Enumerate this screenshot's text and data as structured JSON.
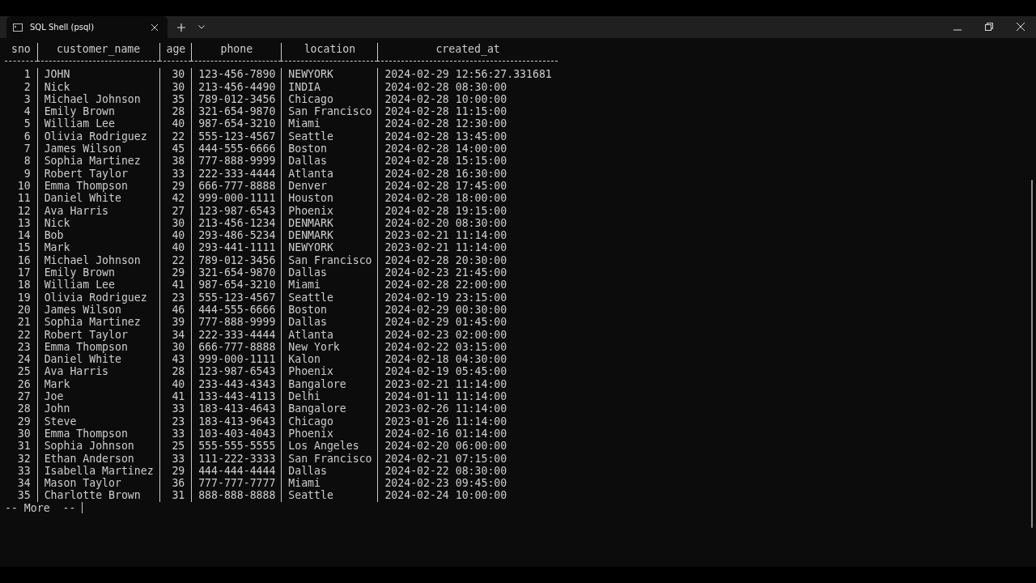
{
  "window": {
    "title": "SQL Shell (psql)"
  },
  "table": {
    "columns": [
      "sno",
      "customer_name",
      "age",
      "phone",
      "location",
      "created_at"
    ],
    "rows": [
      [
        "1",
        "JOHN",
        "30",
        "123-456-7890",
        "NEWYORK",
        "2024-02-29 12:56:27.331681"
      ],
      [
        "2",
        "Nick",
        "30",
        "213-456-4490",
        "INDIA",
        "2024-02-28 08:30:00"
      ],
      [
        "3",
        "Michael Johnson",
        "35",
        "789-012-3456",
        "Chicago",
        "2024-02-28 10:00:00"
      ],
      [
        "4",
        "Emily Brown",
        "28",
        "321-654-9870",
        "San Francisco",
        "2024-02-28 11:15:00"
      ],
      [
        "5",
        "William Lee",
        "40",
        "987-654-3210",
        "Miami",
        "2024-02-28 12:30:00"
      ],
      [
        "6",
        "Olivia Rodriguez",
        "22",
        "555-123-4567",
        "Seattle",
        "2024-02-28 13:45:00"
      ],
      [
        "7",
        "James Wilson",
        "45",
        "444-555-6666",
        "Boston",
        "2024-02-28 14:00:00"
      ],
      [
        "8",
        "Sophia Martinez",
        "38",
        "777-888-9999",
        "Dallas",
        "2024-02-28 15:15:00"
      ],
      [
        "9",
        "Robert Taylor",
        "33",
        "222-333-4444",
        "Atlanta",
        "2024-02-28 16:30:00"
      ],
      [
        "10",
        "Emma Thompson",
        "29",
        "666-777-8888",
        "Denver",
        "2024-02-28 17:45:00"
      ],
      [
        "11",
        "Daniel White",
        "42",
        "999-000-1111",
        "Houston",
        "2024-02-28 18:00:00"
      ],
      [
        "12",
        "Ava Harris",
        "27",
        "123-987-6543",
        "Phoenix",
        "2024-02-28 19:15:00"
      ],
      [
        "13",
        "Nick",
        "30",
        "213-456-1234",
        "DENMARK",
        "2024-02-20 08:30:00"
      ],
      [
        "14",
        "Bob",
        "40",
        "293-486-5234",
        "DENMARK",
        "2023-02-21 11:14:00"
      ],
      [
        "15",
        "Mark",
        "40",
        "293-441-1111",
        "NEWYORK",
        "2023-02-21 11:14:00"
      ],
      [
        "16",
        "Michael Johnson",
        "22",
        "789-012-3456",
        "San Francisco",
        "2024-02-28 20:30:00"
      ],
      [
        "17",
        "Emily Brown",
        "29",
        "321-654-9870",
        "Dallas",
        "2024-02-23 21:45:00"
      ],
      [
        "18",
        "William Lee",
        "41",
        "987-654-3210",
        "Miami",
        "2024-02-28 22:00:00"
      ],
      [
        "19",
        "Olivia Rodriguez",
        "23",
        "555-123-4567",
        "Seattle",
        "2024-02-19 23:15:00"
      ],
      [
        "20",
        "James Wilson",
        "46",
        "444-555-6666",
        "Boston",
        "2024-02-29 00:30:00"
      ],
      [
        "21",
        "Sophia Martinez",
        "39",
        "777-888-9999",
        "Dallas",
        "2024-02-29 01:45:00"
      ],
      [
        "22",
        "Robert Taylor",
        "34",
        "222-333-4444",
        "Atlanta",
        "2024-02-23 02:00:00"
      ],
      [
        "23",
        "Emma Thompson",
        "30",
        "666-777-8888",
        "New York",
        "2024-02-22 03:15:00"
      ],
      [
        "24",
        "Daniel White",
        "43",
        "999-000-1111",
        "Kalon",
        "2024-02-18 04:30:00"
      ],
      [
        "25",
        "Ava Harris",
        "28",
        "123-987-6543",
        "Phoenix",
        "2024-02-19 05:45:00"
      ],
      [
        "26",
        "Mark",
        "40",
        "233-443-4343",
        "Bangalore",
        "2023-02-21 11:14:00"
      ],
      [
        "27",
        "Joe",
        "41",
        "133-443-4113",
        "Delhi",
        "2024-01-11 11:14:00"
      ],
      [
        "28",
        "John",
        "33",
        "183-413-4643",
        "Bangalore",
        "2023-02-26 11:14:00"
      ],
      [
        "29",
        "Steve",
        "23",
        "183-413-9643",
        "Chicago",
        "2023-01-26 11:14:00"
      ],
      [
        "30",
        "Emma Thompson",
        "33",
        "103-403-4043",
        "Phoenix",
        "2024-02-16 01:14:00"
      ],
      [
        "31",
        "Sophia Johnson",
        "25",
        "555-555-5555",
        "Los Angeles",
        "2024-02-20 06:00:00"
      ],
      [
        "32",
        "Ethan Anderson",
        "33",
        "111-222-3333",
        "San Francisco",
        "2024-02-21 07:15:00"
      ],
      [
        "33",
        "Isabella Martinez",
        "29",
        "444-444-4444",
        "Dallas",
        "2024-02-22 08:30:00"
      ],
      [
        "34",
        "Mason Taylor",
        "36",
        "777-777-7777",
        "Miami",
        "2024-02-23 09:45:00"
      ],
      [
        "35",
        "Charlotte Brown",
        "31",
        "888-888-8888",
        "Seattle",
        "2024-02-24 10:00:00"
      ]
    ]
  },
  "pager": "-- More  --"
}
